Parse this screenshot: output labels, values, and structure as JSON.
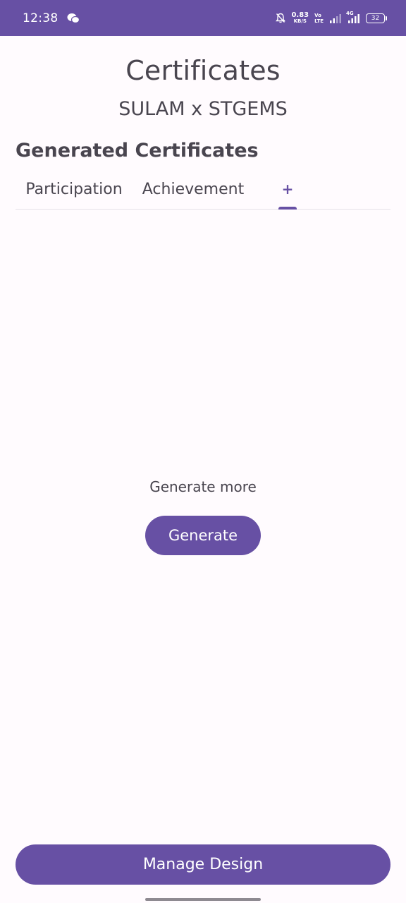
{
  "status_bar": {
    "time": "12:38",
    "net_speed": "0.83",
    "net_unit": "KB/S",
    "volte_top": "Vo",
    "volte_bottom": "LTE",
    "network_type": "4G",
    "battery": "32",
    "icons": [
      "wechat-icon",
      "bell-off-icon",
      "signal-icon",
      "signal-4g-icon",
      "battery-icon"
    ]
  },
  "header": {
    "title": "Certificates",
    "subtitle": "SULAM x STGEMS"
  },
  "section": {
    "title": "Generated Certificates"
  },
  "tabs": [
    {
      "label": "Participation"
    },
    {
      "label": "Achievement"
    },
    {
      "label": "+"
    }
  ],
  "empty_state": {
    "message": "Generate more",
    "button_label": "Generate"
  },
  "footer": {
    "manage_label": "Manage Design"
  },
  "colors": {
    "primary": "#6750a4",
    "background": "#fffbfe",
    "text": "#49454f"
  }
}
